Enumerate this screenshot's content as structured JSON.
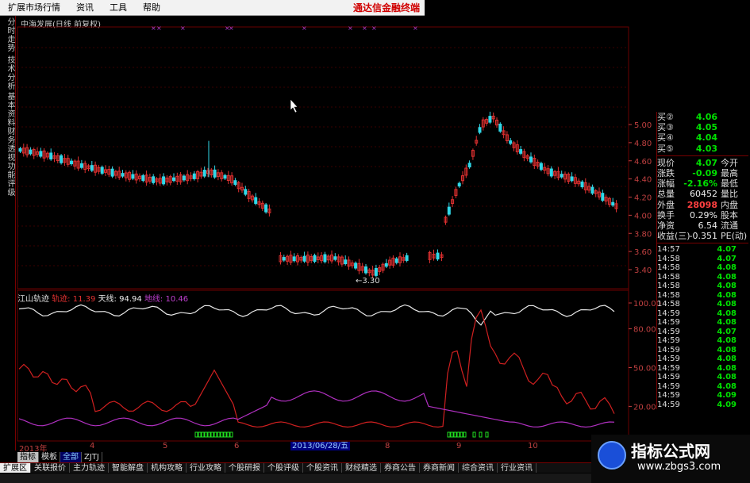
{
  "menu": {
    "items": [
      "扩展市场行情",
      "资讯",
      "工具",
      "帮助"
    ],
    "brand": "通达信金融终端"
  },
  "side_tabs": [
    "分时走势",
    "技术分析",
    "基本资料",
    "财务透视",
    "功能评级"
  ],
  "chart_title": "中海发展(日线 前复权)",
  "price_axis": [
    "5.00",
    "4.80",
    "4.60",
    "4.40",
    "4.20",
    "4.00",
    "3.80",
    "3.60",
    "3.40"
  ],
  "low_label": "←3.30",
  "indicator": {
    "name": "江山轨迹",
    "l1": "轨迹: 11.39",
    "l2": "天线: 94.94",
    "l3": "地线: 10.46",
    "axis": [
      "100.00",
      "80.00",
      "50.00",
      "20.00"
    ]
  },
  "x_axis": {
    "year": "2013年",
    "labels": [
      "4",
      "5",
      "6",
      "8",
      "9",
      "10"
    ],
    "cursor_date": "2013/06/28/五"
  },
  "quote": {
    "bids": [
      {
        "label": "买②",
        "price": "4.06"
      },
      {
        "label": "买③",
        "price": "4.05"
      },
      {
        "label": "买④",
        "price": "4.04"
      },
      {
        "label": "买⑤",
        "price": "4.03"
      }
    ],
    "rows": [
      {
        "l": "现价",
        "v": "4.07",
        "c": "green",
        "r": "今开"
      },
      {
        "l": "涨跌",
        "v": "-0.09",
        "c": "green",
        "r": "最高"
      },
      {
        "l": "涨幅",
        "v": "-2.16%",
        "c": "green",
        "r": "最低"
      },
      {
        "l": "总量",
        "v": "60452",
        "c": "white",
        "r": "量比"
      },
      {
        "l": "外盘",
        "v": "28098",
        "c": "red",
        "r": "内盘"
      },
      {
        "l": "换手",
        "v": "0.29%",
        "c": "white",
        "r": "股本"
      },
      {
        "l": "净资",
        "v": "6.54",
        "c": "white",
        "r": "流通"
      },
      {
        "l": "收益(三)",
        "v": "-0.351",
        "c": "white",
        "r": "PE(动)"
      }
    ]
  },
  "ticks": [
    {
      "t": "14:57",
      "p": "4.07"
    },
    {
      "t": "14:58",
      "p": "4.07"
    },
    {
      "t": "14:58",
      "p": "4.08"
    },
    {
      "t": "14:58",
      "p": "4.08"
    },
    {
      "t": "14:58",
      "p": "4.08"
    },
    {
      "t": "14:58",
      "p": "4.08"
    },
    {
      "t": "14:58",
      "p": "4.08"
    },
    {
      "t": "14:59",
      "p": "4.08"
    },
    {
      "t": "14:59",
      "p": "4.08"
    },
    {
      "t": "14:59",
      "p": "4.07"
    },
    {
      "t": "14:59",
      "p": "4.08"
    },
    {
      "t": "14:59",
      "p": "4.08"
    },
    {
      "t": "14:59",
      "p": "4.08"
    },
    {
      "t": "14:59",
      "p": "4.08"
    },
    {
      "t": "14:59",
      "p": "4.08"
    },
    {
      "t": "14:59",
      "p": "4.08"
    },
    {
      "t": "14:59",
      "p": "4.09"
    },
    {
      "t": "14:59",
      "p": "4.09"
    }
  ],
  "tabs": [
    "指标",
    "模板",
    "全部",
    "ZJTJ"
  ],
  "bottom_tabs": [
    "扩展区",
    "关联报价",
    "主力轨迹",
    "智能解盘",
    "机构攻略",
    "行业攻略",
    "个股研报",
    "个股评级",
    "个股资讯",
    "财经精选",
    "券商公告",
    "券商新闻",
    "综合资讯",
    "行业资讯"
  ],
  "watermark": {
    "title": "指标公式网",
    "url": "www.zbgs3.com"
  },
  "colors": {
    "up": "#e03030",
    "down": "#30d8e8",
    "grid": "#6a0000",
    "white_line": "#e8e8e8",
    "red_line": "#d02020",
    "purple_line": "#b030c0"
  }
}
